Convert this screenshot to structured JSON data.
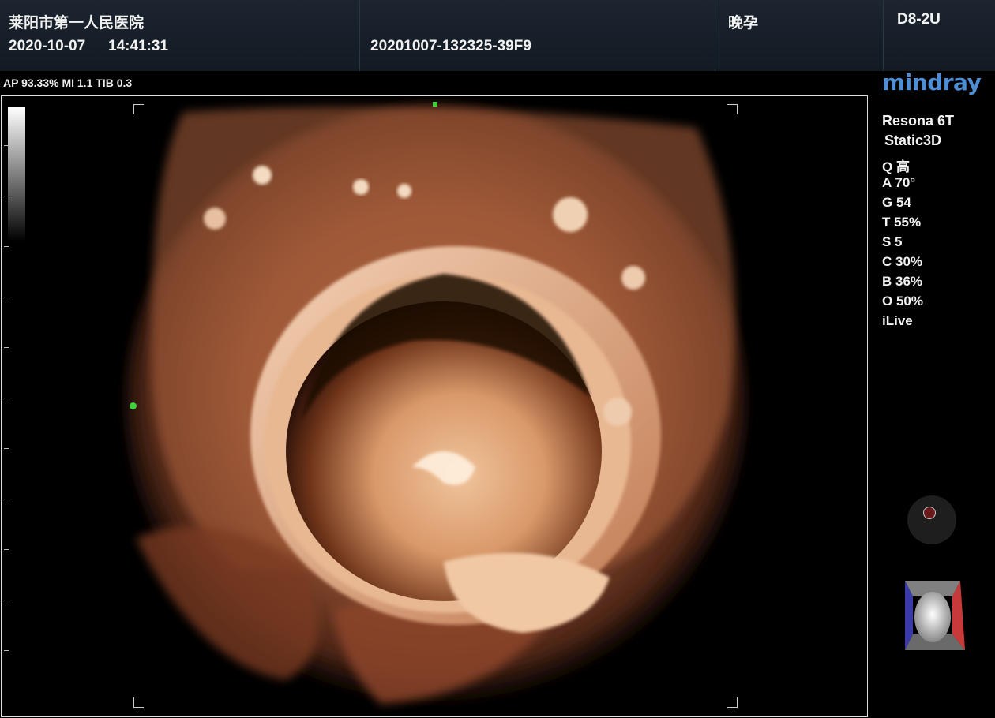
{
  "header": {
    "hospital": "莱阳市第一人民医院",
    "date": "2020-10-07",
    "time": "14:41:31",
    "exam_id": "20201007-132325-39F9",
    "exam_type": "晚孕",
    "probe": "D8-2U"
  },
  "acoustic": "AP 93.33%  MI 1.1 TIB 0.3",
  "brand": "mindray",
  "right_panel": {
    "model": "Resona 6T",
    "mode": "Static3D",
    "params": [
      "Q 高",
      "A 70°",
      "G 54",
      "T 55%",
      "S 5",
      "C 30%",
      "B 36%",
      "O 50%",
      "iLive"
    ]
  },
  "colors": {
    "header_bg": "#18212b",
    "brand": "#4d8ed4",
    "marker_green": "#3bd23b",
    "tissue": "#c8825a"
  }
}
